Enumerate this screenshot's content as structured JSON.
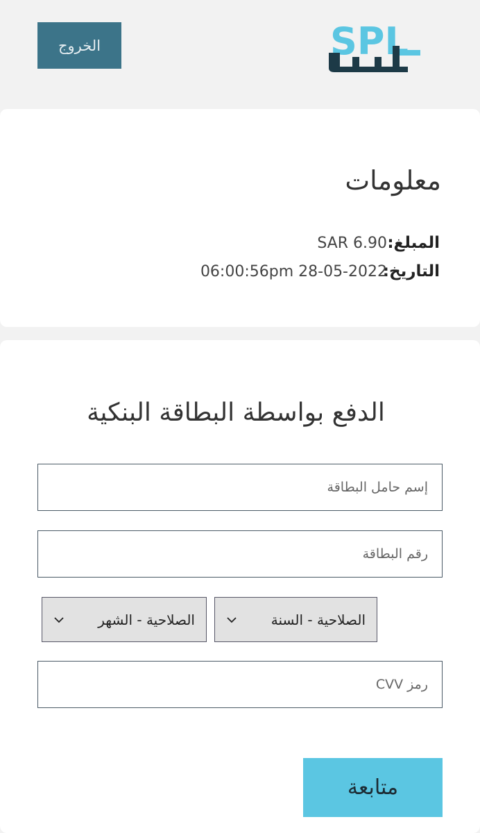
{
  "header": {
    "logout_label": "الخروج",
    "logo_text": "SPL",
    "logo_colors": {
      "light": "#5bc6e2",
      "dark": "#1d3a47"
    }
  },
  "info": {
    "title": "معلومات",
    "amount_label": "المبلغ:",
    "amount_value": "SAR 6.90",
    "date_label": "التاريخ:",
    "date_value": "06:00:56pm 28-05-2022"
  },
  "payment": {
    "title": "الدفع بواسطة البطاقة البنكية",
    "cardholder_placeholder": "إسم حامل البطاقة",
    "card_number_placeholder": "رقم البطاقة",
    "expiry_year_label": "الصلاحية - السنة",
    "expiry_month_label": "الصلاحية - الشهر",
    "cvv_placeholder": "رمز CVV",
    "continue_label": "متابعة"
  },
  "colors": {
    "primary_button": "#3c7489",
    "accent_button": "#5bc6e2",
    "background": "#f2f2f2"
  }
}
